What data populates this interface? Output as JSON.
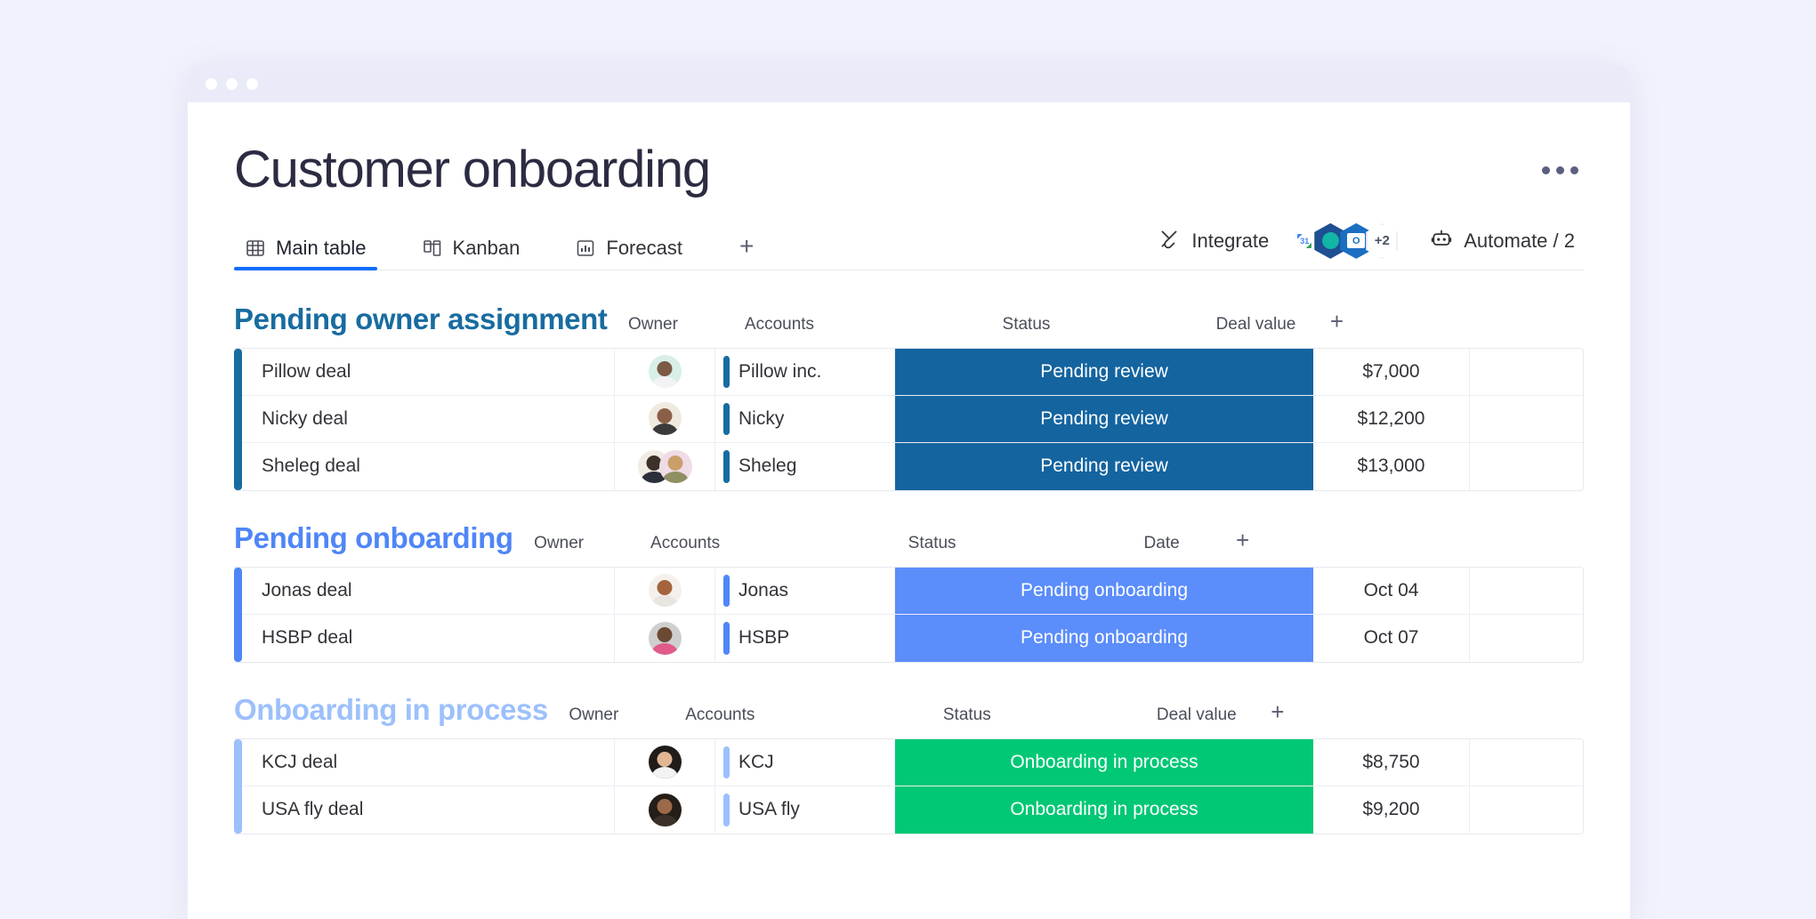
{
  "window": {
    "dots": [
      "close",
      "minimize",
      "maximize"
    ]
  },
  "header": {
    "title": "Customer onboarding",
    "overflow_menu": "more-options"
  },
  "tabs": [
    {
      "label": "Main table",
      "icon": "table-icon",
      "active": true
    },
    {
      "label": "Kanban",
      "icon": "kanban-icon",
      "active": false
    },
    {
      "label": "Forecast",
      "icon": "chart-icon",
      "active": false
    }
  ],
  "tab_add_label": "+",
  "toolbar": {
    "integrate_label": "Integrate",
    "integrate_icon": "plug-icon",
    "automate_label": "Automate / 2",
    "automate_icon": "robot-icon",
    "integrations": [
      {
        "name": "google-calendar",
        "label": "31"
      },
      {
        "name": "monday-teal",
        "label": ""
      },
      {
        "name": "outlook",
        "label": "O"
      },
      {
        "name": "more-integrations",
        "label": "+2"
      }
    ]
  },
  "column_headers": {
    "owner": "Owner",
    "accounts": "Accounts",
    "status": "Status",
    "deal_value": "Deal value",
    "date": "Date",
    "add": "+"
  },
  "colors": {
    "pending_review": "#1464a0",
    "pending_onboarding": "#5b8dfb",
    "onboarding_in_process": "#00c875",
    "group1_accent": "#186ca0",
    "group2_accent": "#4f86f7",
    "group3_accent": "#9cc0fb",
    "tab_underline": "#0f6dfb"
  },
  "groups": [
    {
      "name": "Pending owner assignment",
      "color": "#186ca0",
      "last_column": "Deal value",
      "rows": [
        {
          "name": "Pillow deal",
          "account": "Pillow inc.",
          "status": "Pending review",
          "status_color": "#1464a0",
          "last": "$7,000",
          "owners": [
            {
              "bg": "#d8efe9",
              "head": "#7d5a44",
              "body": "#f2f3f5"
            }
          ]
        },
        {
          "name": "Nicky deal",
          "account": "Nicky",
          "status": "Pending review",
          "status_color": "#1464a0",
          "last": "$12,200",
          "owners": [
            {
              "bg": "#efe9df",
              "head": "#8b5f47",
              "body": "#3a3a3a"
            }
          ]
        },
        {
          "name": "Sheleg deal",
          "account": "Sheleg",
          "status": "Pending review",
          "status_color": "#1464a0",
          "last": "$13,000",
          "owners": [
            {
              "bg": "#f0ece4",
              "head": "#3d3228",
              "body": "#2a2f3a"
            },
            {
              "bg": "#efdce7",
              "head": "#c9a06a",
              "body": "#8f8f62"
            }
          ]
        }
      ]
    },
    {
      "name": "Pending onboarding",
      "color": "#4f86f7",
      "last_column": "Date",
      "rows": [
        {
          "name": "Jonas deal",
          "account": "Jonas",
          "status": "Pending onboarding",
          "status_color": "#5b8dfb",
          "last": "Oct 04",
          "owners": [
            {
              "bg": "#f4f1ec",
              "head": "#a5643c",
              "body": "#e9e6e1"
            }
          ]
        },
        {
          "name": "HSBP deal",
          "account": "HSBP",
          "status": "Pending onboarding",
          "status_color": "#5b8dfb",
          "last": "Oct 07",
          "owners": [
            {
              "bg": "#cfcfcf",
              "head": "#6b4a34",
              "body": "#e05b8a"
            }
          ]
        }
      ]
    },
    {
      "name": "Onboarding in process",
      "color": "#9cc0fb",
      "last_column": "Deal value",
      "rows": [
        {
          "name": "KCJ deal",
          "account": "KCJ",
          "status": "Onboarding in process",
          "status_color": "#00c875",
          "last": "$8,750",
          "owners": [
            {
              "bg": "#201c1a",
              "head": "#e0b694",
              "body": "#f3f3f3"
            }
          ]
        },
        {
          "name": "USA fly deal",
          "account": "USA fly",
          "status": "Onboarding in process",
          "status_color": "#00c875",
          "last": "$9,200",
          "owners": [
            {
              "bg": "#241d18",
              "head": "#9b6a49",
              "body": "#3c3128"
            }
          ]
        }
      ]
    }
  ]
}
